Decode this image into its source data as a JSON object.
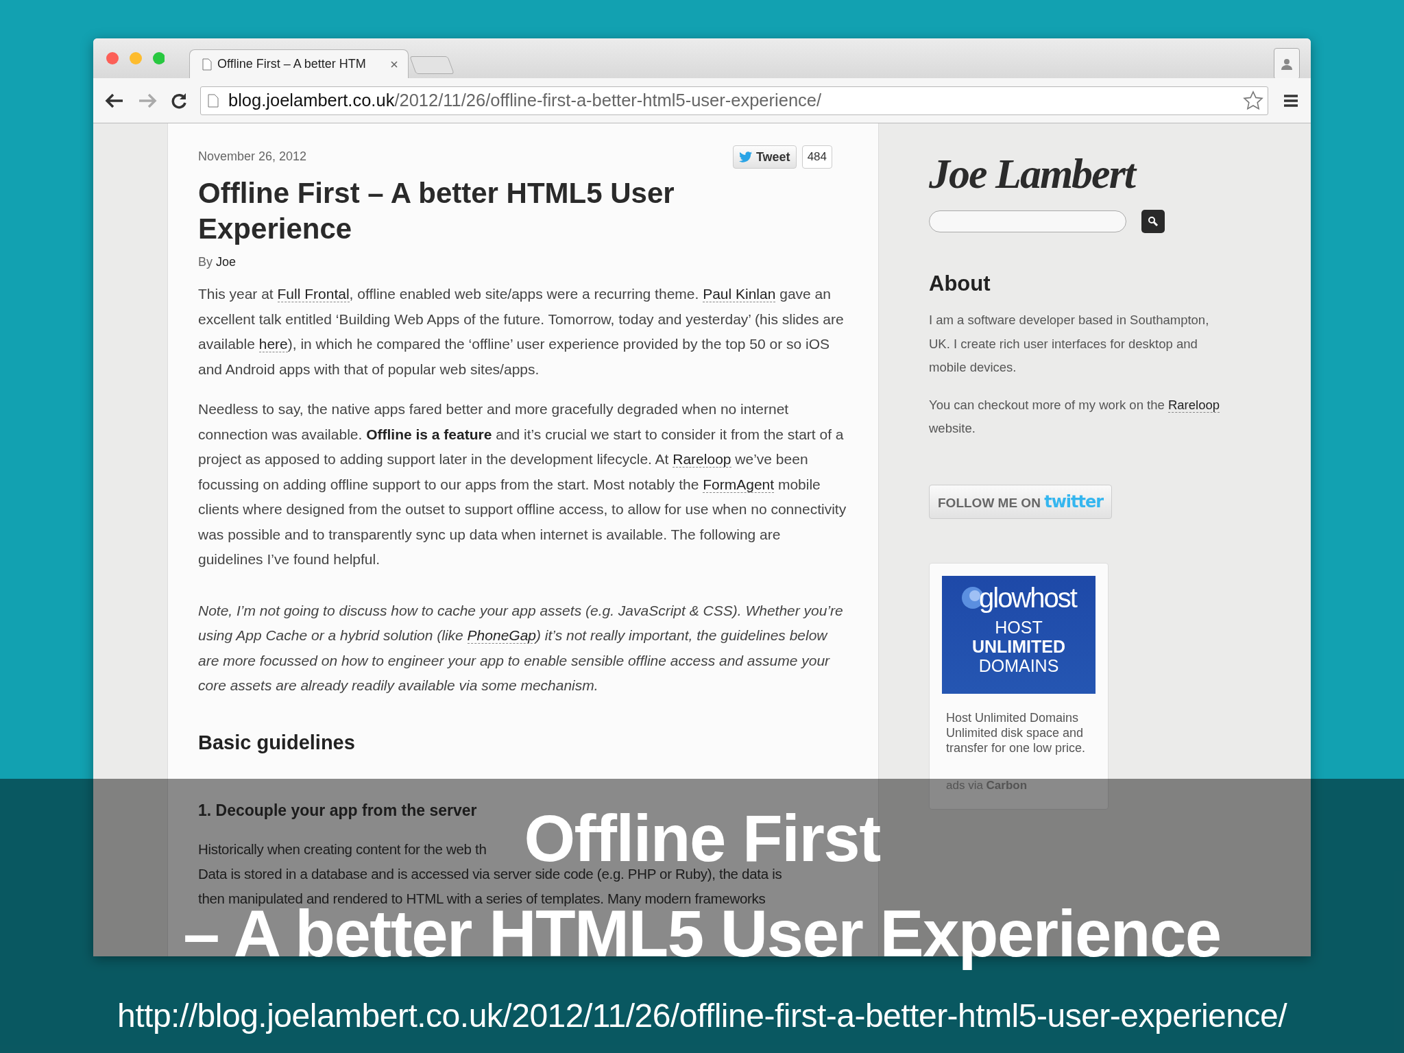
{
  "browser": {
    "tab": {
      "title": "Offline First – A better HTM"
    },
    "url": {
      "host": "blog.joelambert.co.uk",
      "path": "/2012/11/26/offline-first-a-better-html5-user-experience/"
    }
  },
  "article": {
    "date": "November 26, 2012",
    "tweet": {
      "label": "Tweet",
      "count": "484"
    },
    "title": "Offline First – A better HTML5 User Experience",
    "byline": {
      "prefix": "By",
      "author": "Joe"
    },
    "paragraphs": [
      {
        "kind": "normal",
        "runs": [
          {
            "kind": "text",
            "text": "This year at "
          },
          {
            "kind": "link",
            "text": "Full Frontal"
          },
          {
            "kind": "text",
            "text": ", offline enabled web site/apps were a recurring theme. "
          },
          {
            "kind": "link",
            "text": "Paul Kinlan"
          },
          {
            "kind": "text",
            "text": " gave an excellent talk entitled ‘Building Web Apps of the future. Tomorrow, today and yesterday’ (his slides are available "
          },
          {
            "kind": "link",
            "text": "here"
          },
          {
            "kind": "text",
            "text": "), in which he compared the ‘offline’ user experience provided by the top 50 or so iOS and Android apps with that of popular web sites/apps."
          }
        ]
      },
      {
        "kind": "normal",
        "runs": [
          {
            "kind": "text",
            "text": "Needless to say, the native apps fared better and more gracefully degraded when no internet connection was available. "
          },
          {
            "kind": "bold",
            "text": "Offline is a feature"
          },
          {
            "kind": "text",
            "text": " and it’s crucial we start to consider it from the start of a project as apposed to adding support later in the development lifecycle. At "
          },
          {
            "kind": "link",
            "text": "Rareloop"
          },
          {
            "kind": "text",
            "text": " we’ve been focussing on adding offline support to our apps from the start. Most notably the "
          },
          {
            "kind": "link",
            "text": "FormAgent"
          },
          {
            "kind": "text",
            "text": " mobile clients where designed from the outset to support offline access, to allow for use when no connectivity was possible and to transparently sync up data when internet is available. The following are guidelines I’ve found helpful."
          }
        ]
      },
      {
        "kind": "italic",
        "runs": [
          {
            "kind": "text",
            "text": "Note, I’m not going to discuss how to cache your app assets (e.g. JavaScript & CSS). Whether you’re using App Cache or a hybrid solution (like "
          },
          {
            "kind": "link",
            "text": "PhoneGap"
          },
          {
            "kind": "text",
            "text": ") it’s not really important, the guidelines below are more focussed on how to engineer your app to enable sensible offline access and assume your core assets are already readily available via some mechanism."
          }
        ]
      }
    ],
    "heading": "Basic guidelines",
    "subheading": "1. Decouple your app from the server",
    "partial_lines": [
      "Historically when creating content for the web th",
      "Data is stored in a database and is accessed via server side code (e.g. PHP or Ruby), the data is",
      "then manipulated and rendered to HTML with a series of templates. Many modern frameworks"
    ]
  },
  "sidebar": {
    "logo": "Joe Lambert",
    "about_heading": "About",
    "about": [
      [
        {
          "kind": "text",
          "text": "I am a software developer based in Southampton, UK. I create rich user interfaces for desktop and mobile devices."
        }
      ],
      [
        {
          "kind": "text",
          "text": "You can checkout more of my work on the "
        },
        {
          "kind": "link",
          "text": "Rareloop"
        },
        {
          "kind": "text",
          "text": " website."
        }
      ]
    ],
    "follow": {
      "label": "FOLLOW ME ON",
      "brand": "twitter"
    },
    "ad": {
      "logo": "glowhost",
      "banner_lines": [
        "HOST",
        "UNLIMITED",
        "DOMAINS"
      ],
      "text": "Host Unlimited Domains Unlimited disk space and transfer for one low price.",
      "credit": "ads via **Carbon**"
    }
  },
  "slide": {
    "title_lines": [
      "Offline First",
      "– A better HTML5 User Experience"
    ],
    "url": "http://blog.joelambert.co.uk/2012/11/26/offline-first-a-better-html5-user-experience/"
  }
}
